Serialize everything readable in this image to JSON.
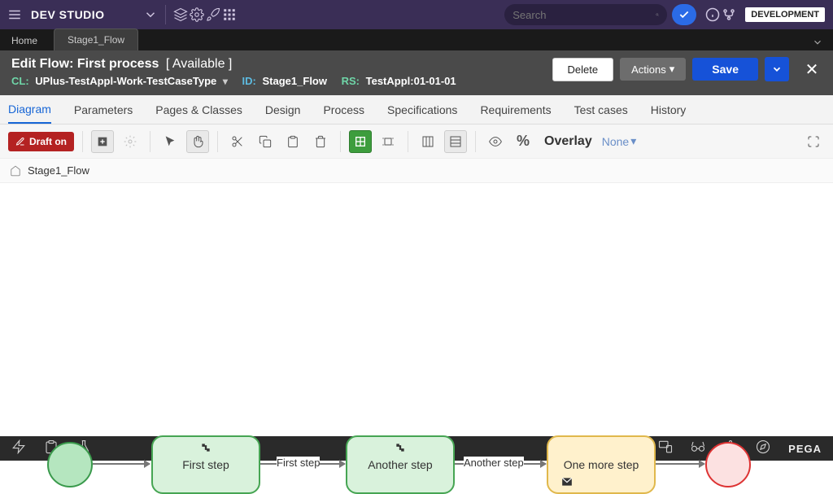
{
  "topbar": {
    "title": "DEV STUDIO",
    "env": "DEVELOPMENT",
    "search_placeholder": "Search"
  },
  "tabs": {
    "home": "Home",
    "active": "Stage1_Flow"
  },
  "header": {
    "title": "Edit  Flow: First process",
    "status": "[ Available ]",
    "cl_label": "CL:",
    "cl": "UPlus-TestAppl-Work-TestCaseType",
    "id_label": "ID:",
    "id": "Stage1_Flow",
    "rs_label": "RS:",
    "rs": "TestAppl:01-01-01",
    "delete": "Delete",
    "actions": "Actions",
    "save": "Save"
  },
  "subtabs": [
    "Diagram",
    "Parameters",
    "Pages & Classes",
    "Design",
    "Process",
    "Specifications",
    "Requirements",
    "Test cases",
    "History"
  ],
  "toolbar": {
    "draft": "Draft on",
    "overlay_label": "Overlay",
    "overlay_value": "None"
  },
  "breadcrumb": "Stage1_Flow",
  "flow": {
    "step1": "First step",
    "step2": "Another step",
    "step3": "One more step",
    "conn1": "First step",
    "conn2": "Another step"
  },
  "footer": {
    "brand": "PEGA"
  }
}
